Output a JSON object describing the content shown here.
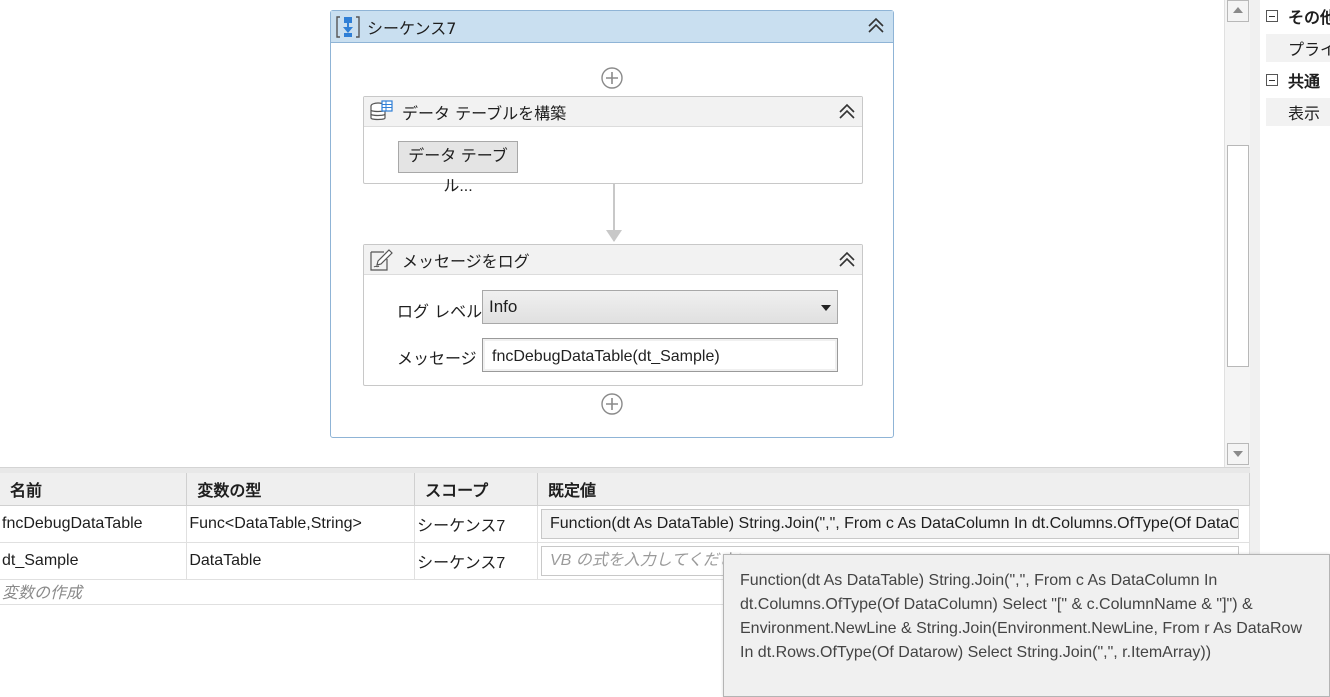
{
  "sequence": {
    "title": "シーケンス7"
  },
  "build_table": {
    "title": "データ テーブルを構築",
    "button_label": "データ テーブル..."
  },
  "log_message": {
    "title": "メッセージをログ",
    "level_label": "ログ レベル",
    "level_value": "Info",
    "message_label": "メッセージ",
    "message_value": "fncDebugDataTable(dt_Sample)"
  },
  "properties": {
    "category_other": "その他",
    "item_private": "プライ",
    "category_common": "共通",
    "item_display": "表示"
  },
  "variables": {
    "headers": [
      "名前",
      "変数の型",
      "スコープ",
      "既定値"
    ],
    "rows": [
      {
        "name": "fncDebugDataTable",
        "type": "Func<DataTable,String>",
        "scope": "シーケンス7",
        "default": "Function(dt As DataTable) String.Join(\",\", From c As DataColumn In dt.Columns.OfType(Of DataColumn"
      },
      {
        "name": "dt_Sample",
        "type": "DataTable",
        "scope": "シーケンス7",
        "default": "VB の式を入力してください"
      }
    ],
    "create_label": "変数の作成"
  },
  "tooltip": {
    "text": "Function(dt As DataTable) String.Join(\",\", From c As DataColumn In dt.Columns.OfType(Of DataColumn) Select \"[\" & c.ColumnName & \"]\") & Environment.NewLine & String.Join(Environment.NewLine, From r As DataRow In dt.Rows.OfType(Of Datarow) Select String.Join(\",\", r.ItemArray))"
  },
  "colors": {
    "sequence_header": "#c9dff0",
    "sequence_border": "#8fb4d6",
    "sequence_icon": "#2f7fd6",
    "tooltip_bg": "#f0f0f0"
  }
}
